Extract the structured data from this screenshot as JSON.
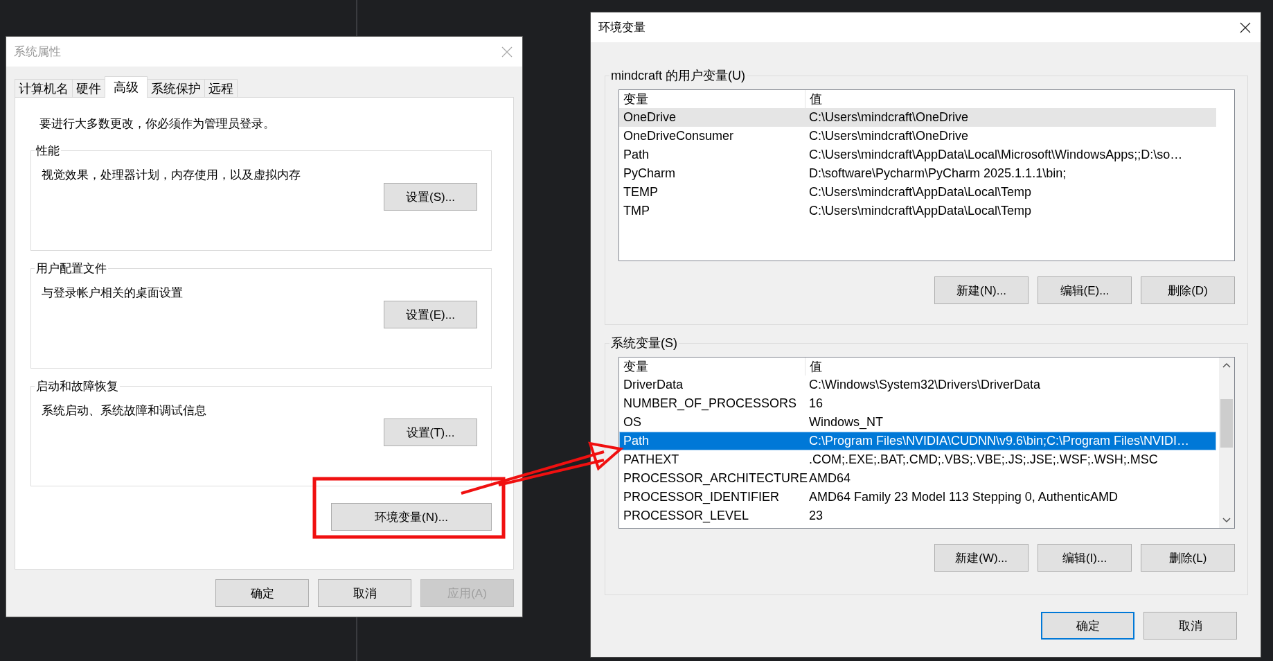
{
  "system_properties": {
    "title": "系统属性",
    "active": false,
    "tabs": [
      {
        "label": "计算机名",
        "selected": false
      },
      {
        "label": "硬件",
        "selected": false
      },
      {
        "label": "高级",
        "selected": true
      },
      {
        "label": "系统保护",
        "selected": false
      },
      {
        "label": "远程",
        "selected": false
      }
    ],
    "notice": "要进行大多数更改，你必须作为管理员登录。",
    "groups": [
      {
        "title": "性能",
        "description": "视觉效果，处理器计划，内存使用，以及虚拟内存",
        "button": "设置(S)..."
      },
      {
        "title": "用户配置文件",
        "description": "与登录帐户相关的桌面设置",
        "button": "设置(E)..."
      },
      {
        "title": "启动和故障恢复",
        "description": "系统启动、系统故障和调试信息",
        "button": "设置(T)..."
      }
    ],
    "env_button": "环境变量(N)...",
    "buttons": [
      {
        "label": "确定",
        "disabled": false
      },
      {
        "label": "取消",
        "disabled": false
      },
      {
        "label": "应用(A)",
        "disabled": true
      }
    ]
  },
  "environment_variables": {
    "title": "环境变量",
    "active": true,
    "sections": [
      {
        "title": "mindcraft 的用户变量(U)",
        "focused": false,
        "scrollable": false,
        "columns": [
          "变量",
          "值"
        ],
        "rows": [
          {
            "name": "OneDrive",
            "value": "C:\\Users\\mindcraft\\OneDrive",
            "selected": true
          },
          {
            "name": "OneDriveConsumer",
            "value": "C:\\Users\\mindcraft\\OneDrive",
            "selected": false
          },
          {
            "name": "Path",
            "value": "C:\\Users\\mindcraft\\AppData\\Local\\Microsoft\\WindowsApps;;D:\\so…",
            "selected": false
          },
          {
            "name": "PyCharm",
            "value": "D:\\software\\Pycharm\\PyCharm 2025.1.1.1\\bin;",
            "selected": false
          },
          {
            "name": "TEMP",
            "value": "C:\\Users\\mindcraft\\AppData\\Local\\Temp",
            "selected": false
          },
          {
            "name": "TMP",
            "value": "C:\\Users\\mindcraft\\AppData\\Local\\Temp",
            "selected": false
          }
        ],
        "buttons": [
          "新建(N)...",
          "编辑(E)...",
          "删除(D)"
        ]
      },
      {
        "title": "系统变量(S)",
        "focused": true,
        "scrollable": true,
        "columns": [
          "变量",
          "值"
        ],
        "rows": [
          {
            "name": "DriverData",
            "value": "C:\\Windows\\System32\\Drivers\\DriverData",
            "selected": false
          },
          {
            "name": "NUMBER_OF_PROCESSORS",
            "value": "16",
            "selected": false
          },
          {
            "name": "OS",
            "value": "Windows_NT",
            "selected": false
          },
          {
            "name": "Path",
            "value": "C:\\Program Files\\NVIDIA\\CUDNN\\v9.6\\bin;C:\\Program Files\\NVIDI…",
            "selected": true
          },
          {
            "name": "PATHEXT",
            "value": ".COM;.EXE;.BAT;.CMD;.VBS;.VBE;.JS;.JSE;.WSF;.WSH;.MSC",
            "selected": false
          },
          {
            "name": "PROCESSOR_ARCHITECTURE",
            "value": "AMD64",
            "selected": false
          },
          {
            "name": "PROCESSOR_IDENTIFIER",
            "value": "AMD64 Family 23 Model 113 Stepping 0, AuthenticAMD",
            "selected": false
          },
          {
            "name": "PROCESSOR_LEVEL",
            "value": "23",
            "selected": false
          }
        ],
        "buttons": [
          "新建(W)...",
          "编辑(I)...",
          "删除(L)"
        ]
      }
    ],
    "buttons": [
      {
        "label": "确定",
        "default": true
      },
      {
        "label": "取消",
        "default": false
      }
    ]
  }
}
